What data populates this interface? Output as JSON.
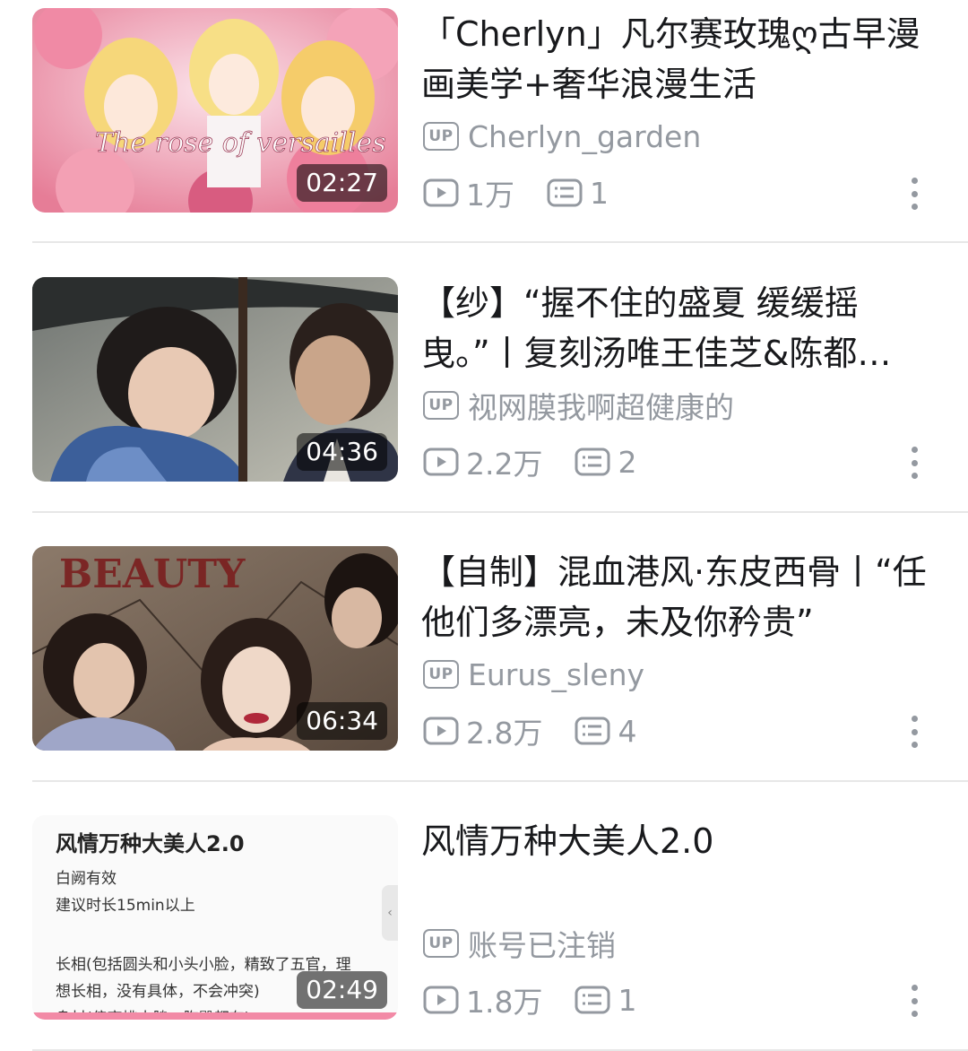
{
  "videos": [
    {
      "title": "「Cherlyn」凡尔赛玫瑰ღ古早漫画美学+奢华浪漫生活",
      "uploader": "Cherlyn_garden",
      "views": "1万",
      "comments": "1",
      "duration": "02:27",
      "thumb_overlay": "The rose of versailles"
    },
    {
      "title": "【纱】“握不住的盛夏 缓缓摇曳。”丨复刻汤唯王佳芝&陈都…",
      "uploader": "视网膜我啊超健康的",
      "views": "2.2万",
      "comments": "2",
      "duration": "04:36"
    },
    {
      "title": "【自制】混血港风·东皮西骨丨“任他们多漂亮，未及你矜贵”",
      "uploader": "Eurus_sleny",
      "views": "2.8万",
      "comments": "4",
      "duration": "06:34",
      "thumb_overlay": "BEAUTY"
    },
    {
      "title": "风情万种大美人2.0",
      "uploader": "账号已注销",
      "views": "1.8万",
      "comments": "1",
      "duration": "02:49",
      "card": {
        "title": "风情万种大美人2.0",
        "line1": "白阙有效",
        "line2": "建议时长15min以上",
        "line3": "长相(包括圆头和小头小脸，精致了五官，理",
        "line4": "想长相，没有具体，不会冲突)",
        "line5": "身材(偏高挑丰腴，胸臀都有)"
      }
    }
  ],
  "badge_label": "UP",
  "colors": {
    "meta": "#9499a0",
    "title": "#18191c",
    "divider": "#e7e7e7"
  },
  "icons": {
    "uploader": "up-badge-icon",
    "views": "play-icon",
    "comments": "danmaku-icon",
    "more": "more-vertical-icon"
  }
}
